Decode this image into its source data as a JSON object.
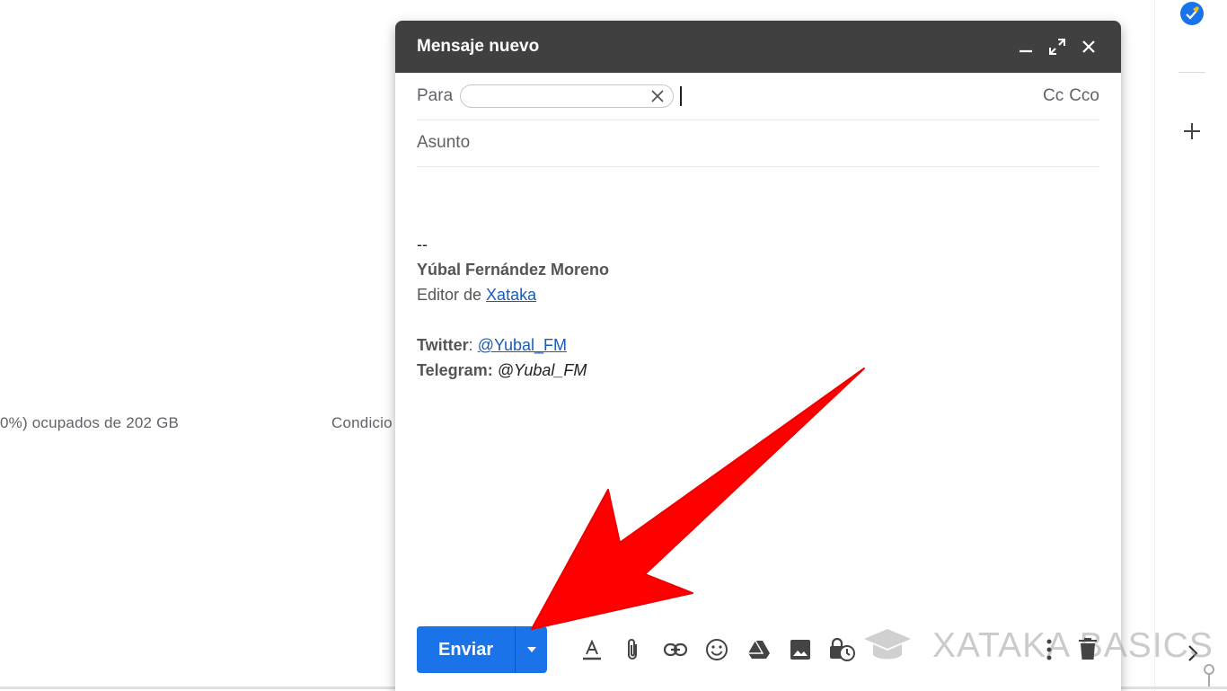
{
  "background": {
    "storage_text": "0%) ocupados de 202 GB",
    "terms_text": "Condicio"
  },
  "right_rail": {
    "tasks_icon": "tasks-icon",
    "add_icon": "plus-icon",
    "expand_icon": "chevron-right-icon"
  },
  "compose": {
    "title": "Mensaje nuevo",
    "header_icons": [
      "minimize-icon",
      "fullscreen-icon",
      "close-icon"
    ],
    "to_label": "Para",
    "to_value": "",
    "cc_label": "Cc",
    "bcc_label": "Cco",
    "subject_placeholder": "Asunto",
    "body": {
      "separator": "--",
      "name": "Yúbal Fernández Moreno",
      "role_prefix": "Editor de ",
      "role_link": "Xataka",
      "twitter_label": "Twitter",
      "twitter_sep": ": ",
      "twitter_link": "@Yubal_FM",
      "telegram_label": "Telegram:",
      "telegram_value": "@Yubal_FM"
    },
    "send_label": "Enviar",
    "toolbar_icons": [
      "format-text-icon",
      "attach-icon",
      "link-icon",
      "emoji-icon",
      "drive-icon",
      "photo-icon",
      "confidential-icon",
      "more-options-icon",
      "trash-icon"
    ]
  },
  "watermark": {
    "text": "XATAKA BASICS"
  },
  "colors": {
    "header": "#404040",
    "send": "#1a73e8",
    "arrow": "#ff0000",
    "link": "#1a5cb8"
  }
}
